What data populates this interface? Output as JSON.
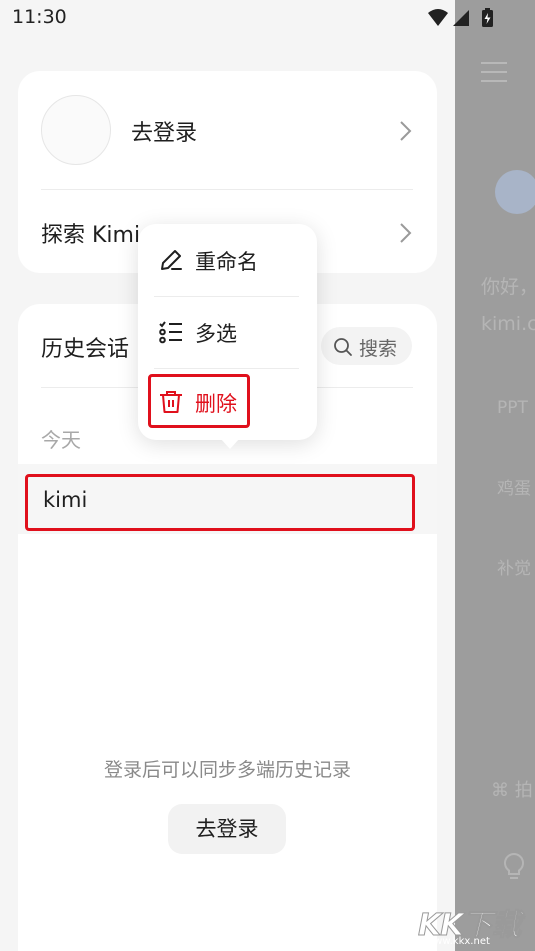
{
  "status_bar": {
    "time": "11:30"
  },
  "drawer": {
    "profile": {
      "login_label": "去登录"
    },
    "explore": {
      "label": "探索 Kimi"
    },
    "history": {
      "title": "历史会话",
      "search_label": "搜索",
      "group_today": "今天",
      "items": [
        {
          "title": "kimi"
        }
      ],
      "sync_hint": "登录后可以同步多端历史记录",
      "login_button": "去登录"
    }
  },
  "context_menu": {
    "items": [
      {
        "label": "重命名",
        "icon": "pencil-icon"
      },
      {
        "label": "多选",
        "icon": "checklist-icon"
      },
      {
        "label": "删除",
        "icon": "trash-icon",
        "color": "#e0101c"
      }
    ]
  },
  "background_chat": {
    "greeting_line1": "你好，",
    "greeting_line2": "kimi.c",
    "suggestions": [
      "PPT",
      "鸡蛋",
      "补觉"
    ],
    "bottom_action": "拍"
  },
  "watermark": {
    "text": "KK下载",
    "url": "www.kkx.net"
  },
  "colors": {
    "accent_red": "#e0101c",
    "overlay": "#9d9d9d"
  }
}
